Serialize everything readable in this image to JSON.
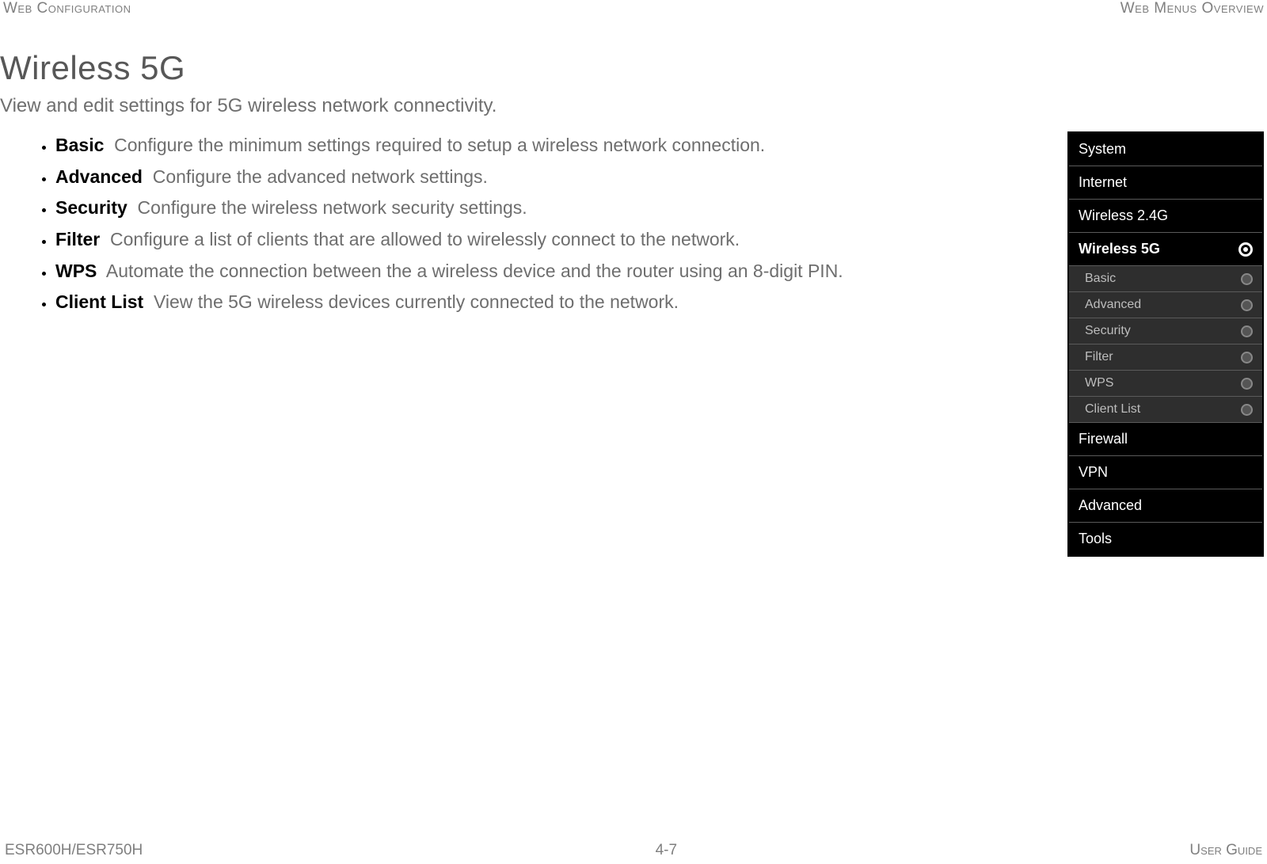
{
  "header": {
    "left": "Web Configuration",
    "right": "Web Menus Overview"
  },
  "title": "Wireless 5G",
  "subtitle": "View and edit settings for 5G wireless network connectivity.",
  "items": [
    {
      "term": "Basic",
      "desc": "Configure the minimum settings required to setup a wireless network connection."
    },
    {
      "term": "Advanced",
      "desc": "Configure the advanced network settings."
    },
    {
      "term": "Security",
      "desc": "Configure the wireless network security settings."
    },
    {
      "term": "Filter",
      "desc": "Configure a list of clients that are allowed to wirelessly connect to the network."
    },
    {
      "term": "WPS",
      "desc": "Automate the connection between the a wireless device and the router using an 8-digit PIN."
    },
    {
      "term": "Client List",
      "desc": "View the 5G wireless devices currently connected to the network."
    }
  ],
  "menu": {
    "top": [
      "System",
      "Internet",
      "Wireless 2.4G"
    ],
    "active": "Wireless 5G",
    "sub": [
      "Basic",
      "Advanced",
      "Security",
      "Filter",
      "WPS",
      "Client List"
    ],
    "bottom": [
      "Firewall",
      "VPN",
      "Advanced",
      "Tools"
    ]
  },
  "footer": {
    "left": "ESR600H/ESR750H",
    "mid": "4-7",
    "right": "User Guide"
  }
}
